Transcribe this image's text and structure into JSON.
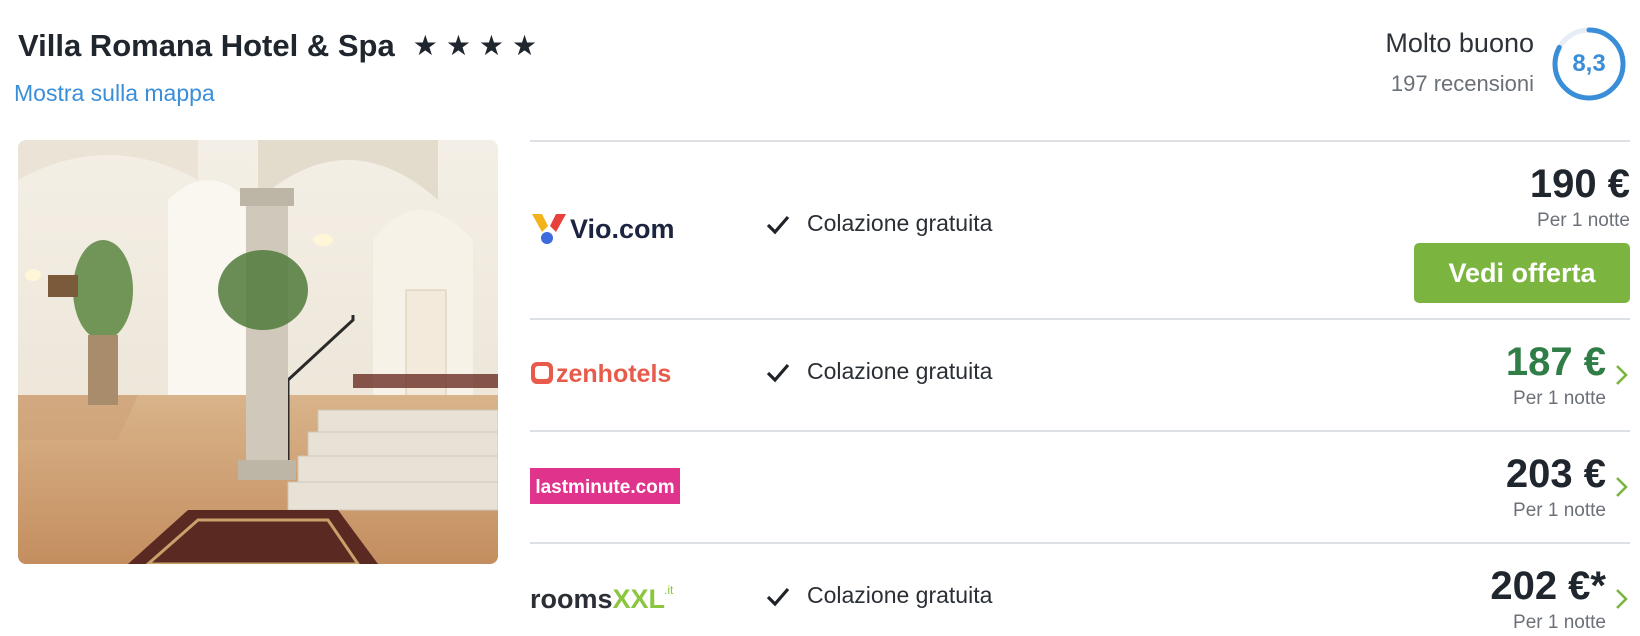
{
  "hotel": {
    "name": "Villa Romana Hotel & Spa",
    "stars": 4,
    "star_glyph": "★",
    "map_link": "Mostra sulla mappa"
  },
  "rating": {
    "label": "Molto buono",
    "reviews": "197 recensioni",
    "score": "8,3",
    "score_value": 8.3,
    "color": "#3a8ed8"
  },
  "photo": {
    "icon": "hotel-lobby-photo"
  },
  "deals": [
    {
      "provider": "Vio.com",
      "perk": "Colazione gratuita",
      "price": "190 €",
      "per_night": "Per 1 notte",
      "cta": "Vedi offerta"
    },
    {
      "provider": "zenhotels",
      "perk": "Colazione gratuita",
      "price": "187 €",
      "per_night": "Per 1 notte"
    },
    {
      "provider": "lastminute.com",
      "perk": "",
      "price": "203 €",
      "per_night": "Per 1 notte"
    },
    {
      "provider": "roomsXXL",
      "provider_suffix": ".it",
      "perk": "Colazione gratuita",
      "price": "202 €*",
      "per_night": "Per 1 notte"
    }
  ],
  "colors": {
    "cta": "#7bb540",
    "best_price": "#2f7d47",
    "link": "#3a8ed8",
    "lastminute_brand": "#e0338b",
    "zenhotels_brand": "#e85b4a",
    "roomsxxl_brand": "#8cc63f"
  }
}
